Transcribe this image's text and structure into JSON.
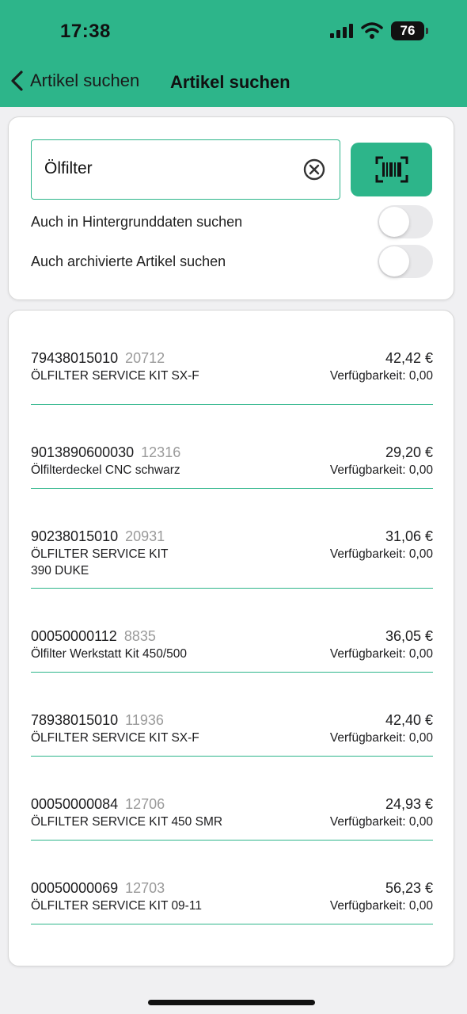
{
  "status_bar": {
    "time": "17:38",
    "battery": "76"
  },
  "nav": {
    "back_label": "Artikel suchen",
    "title": "Artikel suchen"
  },
  "search": {
    "value": "Ölfilter",
    "placeholder": ""
  },
  "toggles": [
    {
      "label": "Auch in Hintergrunddaten suchen",
      "on": false
    },
    {
      "label": "Auch archivierte Artikel suchen",
      "on": false
    }
  ],
  "results": [
    {
      "article_no": "79438015010",
      "id": "20712",
      "name_lines": [
        "ÖLFILTER SERVICE KIT SX-F"
      ],
      "price": "42,42 €",
      "availability": "Verfügbarkeit: 0,00"
    },
    {
      "article_no": "9013890600030",
      "id": "12316",
      "name_lines": [
        "Ölfilterdeckel CNC schwarz"
      ],
      "price": "29,20 €",
      "availability": "Verfügbarkeit: 0,00"
    },
    {
      "article_no": "90238015010",
      "id": "20931",
      "name_lines": [
        "ÖLFILTER SERVICE KIT",
        "390 DUKE"
      ],
      "price": "31,06 €",
      "availability": "Verfügbarkeit: 0,00"
    },
    {
      "article_no": "00050000112",
      "id": "8835",
      "name_lines": [
        "Ölfilter Werkstatt Kit 450/500"
      ],
      "price": "36,05 €",
      "availability": "Verfügbarkeit: 0,00"
    },
    {
      "article_no": "78938015010",
      "id": "11936",
      "name_lines": [
        "ÖLFILTER SERVICE KIT SX-F"
      ],
      "price": "42,40 €",
      "availability": "Verfügbarkeit: 0,00"
    },
    {
      "article_no": "00050000084",
      "id": "12706",
      "name_lines": [
        "ÖLFILTER SERVICE KIT 450 SMR"
      ],
      "price": "24,93 €",
      "availability": "Verfügbarkeit: 0,00"
    },
    {
      "article_no": "00050000069",
      "id": "12703",
      "name_lines": [
        "ÖLFILTER SERVICE KIT 09-11"
      ],
      "price": "56,23 €",
      "availability": "Verfügbarkeit: 0,00"
    }
  ],
  "colors": {
    "accent": "#2db58a",
    "background": "#f0f0f2",
    "secondary_text": "#9a9a9a"
  }
}
